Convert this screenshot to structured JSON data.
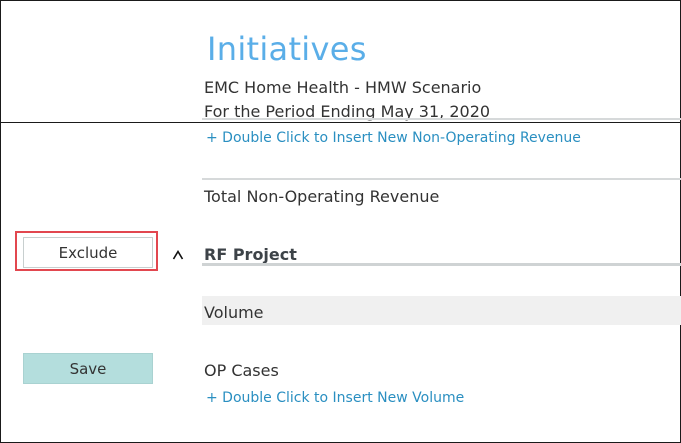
{
  "header": {
    "title": "Initiatives",
    "organization": "EMC Home Health - HMW Scenario",
    "period": "For the Period Ending May 31, 2020"
  },
  "rows": {
    "insert_non_operating": "+ Double Click to Insert New Non-Operating Revenue",
    "total_non_operating": "Total Non-Operating Revenue",
    "project": "RF Project",
    "volume": "Volume",
    "op_cases": "OP Cases",
    "insert_volume": "+ Double Click to Insert New Volume"
  },
  "actions": {
    "exclude_label": "Exclude",
    "save_label": "Save",
    "collapse_icon": "caret-up-icon"
  },
  "colors": {
    "title": "#5aaee8",
    "link": "#2a8fc1",
    "save_button": "#b4dedd",
    "highlight": "#e2474f"
  }
}
